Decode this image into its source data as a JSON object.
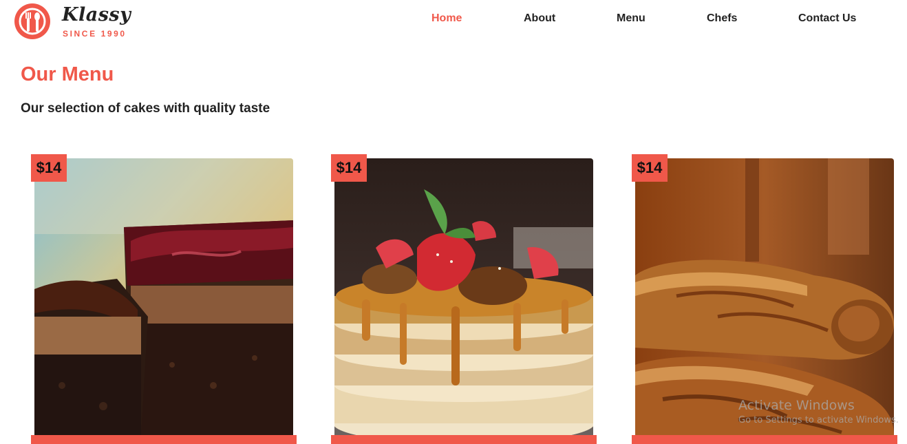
{
  "brand": {
    "name": "Klassy",
    "tagline": "SINCE 1990",
    "icon": "restaurant-plate-icon"
  },
  "nav": {
    "items": [
      {
        "label": "Home",
        "active": true
      },
      {
        "label": "About",
        "active": false
      },
      {
        "label": "Menu",
        "active": false
      },
      {
        "label": "Chefs",
        "active": false
      },
      {
        "label": "Contact Us",
        "active": false
      }
    ]
  },
  "section": {
    "title": "Our Menu",
    "subtitle": "Our selection of cakes with quality taste"
  },
  "menu_items": [
    {
      "price": "$14",
      "image": "chocolate-cake-photo"
    },
    {
      "price": "$14",
      "image": "pancake-stack-photo"
    },
    {
      "price": "$14",
      "image": "bread-loaves-photo"
    }
  ],
  "watermark": {
    "title": "Activate Windows",
    "subtitle": "Go to Settings to activate Windows."
  },
  "colors": {
    "accent": "#f0584a",
    "text": "#222222"
  }
}
